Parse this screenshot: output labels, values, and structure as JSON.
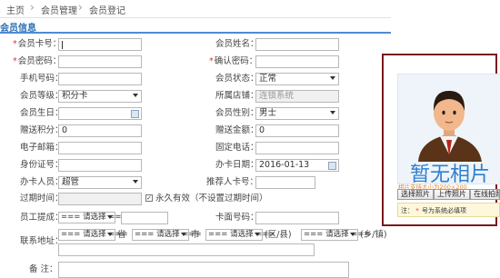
{
  "breadcrumb": {
    "items": [
      "主页",
      "会员管理",
      "会员登记"
    ],
    "sep": "›"
  },
  "section": {
    "title": "会员信息"
  },
  "form": {
    "card_no": {
      "label": "会员卡号：",
      "value": ""
    },
    "name": {
      "label": "会员姓名：",
      "value": ""
    },
    "password": {
      "label": "会员密码：",
      "value": ""
    },
    "confirm_password": {
      "label": "确认密码：",
      "value": ""
    },
    "phone": {
      "label": "手机号码：",
      "value": ""
    },
    "status": {
      "label": "会员状态：",
      "value": "正常"
    },
    "level": {
      "label": "会员等级：",
      "value": "积分卡"
    },
    "store": {
      "label": "所属店铺：",
      "value": "连锁系统"
    },
    "birthday": {
      "label": "会员生日：",
      "value": ""
    },
    "gender": {
      "label": "会员性别：",
      "value": "男士"
    },
    "gift_points": {
      "label": "赠送积分：",
      "value": "0"
    },
    "gift_amount": {
      "label": "赠送金额：",
      "value": "0"
    },
    "email": {
      "label": "电子邮箱：",
      "value": ""
    },
    "landline": {
      "label": "固定电话：",
      "value": ""
    },
    "id_no": {
      "label": "身份证号：",
      "value": ""
    },
    "card_date": {
      "label": "办卡日期：",
      "value": "2016-01-13"
    },
    "handler": {
      "label": "办卡人员：",
      "value": "超管"
    },
    "referrer": {
      "label": "推荐人卡号：",
      "value": ""
    },
    "expire": {
      "label": "过期时间：",
      "value": "",
      "permanent_label": "永久有效（不设置过期时间）",
      "permanent_checked": true
    },
    "employee": {
      "label": "员工提成：",
      "select": "=== 请选择 ==="
    },
    "face_no": {
      "label": "卡面号码：",
      "value": ""
    },
    "address": {
      "label": "联系地址：",
      "province": "=== 请选择 ===",
      "province_unit": "省",
      "city": "=== 请选择 ===",
      "city_unit": "市",
      "district": "=== 请选择 ===",
      "district_unit": "(区/县)",
      "town": "=== 请选择 ===",
      "town_unit": "(乡/镇)"
    },
    "remark": {
      "label": "备 注："
    }
  },
  "photo": {
    "placeholder_text": "暂无相片",
    "hint": "相片支持大小为200×200",
    "buttons": [
      "选择照片",
      "上传照片",
      "在线拍照"
    ],
    "note_prefix": "注：",
    "note_text": "号为系统必填项"
  },
  "colors": {
    "accent": "#2a6fb6",
    "required": "#e03333",
    "highlight_border": "#7a1a1a"
  }
}
